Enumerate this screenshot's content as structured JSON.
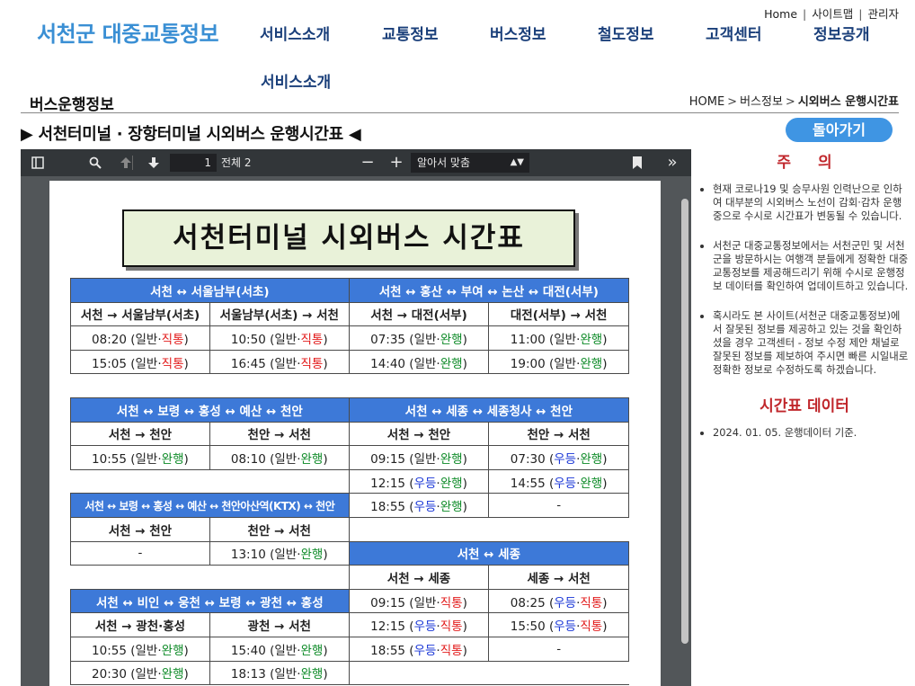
{
  "util": [
    "Home",
    "사이트맵",
    "관리자"
  ],
  "logo": "서천군 대중교통정보",
  "gnb": [
    "서비스소개",
    "교통정보",
    "버스정보",
    "철도정보",
    "고객센터",
    "정보공개"
  ],
  "sub_nav": "서비스소개",
  "page_title": "버스운행정보",
  "breadcrumb": {
    "home": "HOME",
    "mid": "버스정보",
    "current": "시외버스 운행시간표"
  },
  "schedule_title": "▶ 서천터미널 · 장항터미널 시외버스 운행시간표 ◀",
  "back_button": "돌아가기",
  "viewer": {
    "page_current": "1",
    "page_total": "전체 2",
    "zoom": "알아서 맞춤",
    "doc_title": "서천터미널  시외버스  시간표"
  },
  "timetable": {
    "rows": [
      [
        {
          "t": "서천 ↔ 서울남부(서초)",
          "c": "h",
          "span": 2
        },
        {
          "t": "서천 ↔ 홍산 ↔ 부여 ↔ 논산 ↔ 대전(서부)",
          "c": "h",
          "span": 2
        }
      ],
      [
        {
          "t": "서천 → 서울남부(서초)",
          "c": "sh"
        },
        {
          "t": "서울남부(서초) → 서천",
          "c": "sh"
        },
        {
          "t": "서천 → 대전(서부)",
          "c": "sh"
        },
        {
          "t": "대전(서부) → 서천",
          "c": "sh"
        }
      ],
      [
        {
          "time": "08:20",
          "a": "일반",
          "b": "직통"
        },
        {
          "time": "10:50",
          "a": "일반",
          "b": "직통"
        },
        {
          "time": "07:35",
          "a": "일반",
          "b": "완행"
        },
        {
          "time": "11:00",
          "a": "일반",
          "b": "완행"
        }
      ],
      [
        {
          "time": "15:05",
          "a": "일반",
          "b": "직통"
        },
        {
          "time": "16:45",
          "a": "일반",
          "b": "직통"
        },
        {
          "time": "14:40",
          "a": "일반",
          "b": "완행"
        },
        {
          "time": "19:00",
          "a": "일반",
          "b": "완행"
        }
      ],
      [
        {
          "t": "",
          "span": 4,
          "c": "blank"
        }
      ],
      [
        {
          "t": "서천 ↔ 보령 ↔ 홍성 ↔ 예산 ↔ 천안",
          "c": "h",
          "span": 2
        },
        {
          "t": "서천 ↔ 세종 ↔ 세종청사 ↔ 천안",
          "c": "h",
          "span": 2
        }
      ],
      [
        {
          "t": "서천 → 천안",
          "c": "sh"
        },
        {
          "t": "천안 → 서천",
          "c": "sh"
        },
        {
          "t": "서천 → 천안",
          "c": "sh"
        },
        {
          "t": "천안 → 서천",
          "c": "sh"
        }
      ],
      [
        {
          "time": "10:55",
          "a": "일반",
          "b": "완행"
        },
        {
          "time": "08:10",
          "a": "일반",
          "b": "완행"
        },
        {
          "time": "09:15",
          "a": "일반",
          "b": "완행"
        },
        {
          "time": "07:30",
          "a": "우등",
          "b": "완행"
        }
      ],
      [
        {
          "t": "",
          "span": 2,
          "c": "blank"
        },
        {
          "time": "12:15",
          "a": "우등",
          "b": "완행"
        },
        {
          "time": "14:55",
          "a": "우등",
          "b": "완행"
        }
      ],
      [
        {
          "t": "서천 ↔ 보령 ↔ 홍성 ↔ 예산 ↔ 천안아산역(KTX) ↔ 천안",
          "c": "h sm",
          "span": 2
        },
        {
          "time": "18:55",
          "a": "우등",
          "b": "완행"
        },
        {
          "t": "-"
        }
      ],
      [
        {
          "t": "서천 → 천안",
          "c": "sh"
        },
        {
          "t": "천안 → 서천",
          "c": "sh"
        },
        {
          "t": "",
          "span": 2,
          "c": "blank"
        }
      ],
      [
        {
          "t": "-"
        },
        {
          "time": "13:10",
          "a": "일반",
          "b": "완행"
        },
        {
          "t": "서천 ↔ 세종",
          "c": "h",
          "span": 2
        }
      ],
      [
        {
          "t": "",
          "span": 2,
          "c": "blank"
        },
        {
          "t": "서천 → 세종",
          "c": "sh"
        },
        {
          "t": "세종 → 서천",
          "c": "sh"
        }
      ],
      [
        {
          "t": "서천 ↔ 비인 ↔ 웅천 ↔ 보령 ↔ 광천 ↔ 홍성",
          "c": "h",
          "span": 2
        },
        {
          "time": "09:15",
          "a": "일반",
          "b": "직통"
        },
        {
          "time": "08:25",
          "a": "우등",
          "b": "직통"
        }
      ],
      [
        {
          "t": "서천 → 광천·홍성",
          "c": "sh"
        },
        {
          "t": "광천 → 서천",
          "c": "sh"
        },
        {
          "time": "12:15",
          "a": "우등",
          "b": "직통"
        },
        {
          "time": "15:50",
          "a": "우등",
          "b": "직통"
        }
      ],
      [
        {
          "time": "10:55",
          "a": "일반",
          "b": "완행"
        },
        {
          "time": "15:40",
          "a": "일반",
          "b": "완행"
        },
        {
          "time": "18:55",
          "a": "우등",
          "b": "직통"
        },
        {
          "t": "-"
        }
      ],
      [
        {
          "time": "20:30",
          "a": "일반",
          "b": "완행"
        },
        {
          "time": "18:13",
          "a": "일반",
          "b": "완행"
        },
        {
          "t": "",
          "span": 2,
          "c": "blank"
        }
      ]
    ]
  },
  "info": {
    "caution_title": "주 의",
    "caution_items": [
      "현재 코로나19 및 승무사원 인력난으로 인하여 대부분의 시외버스 노선이 감회·감차 운행중으로 수시로 시간표가 변동될 수 있습니다.",
      "서천군 대중교통정보에서는 서천군민 및 서천군을 방문하시는 여행객 분들에게 정확한 대중교통정보를 제공해드리기 위해 수시로 운행정보 데이터를 확인하여 업데이트하고 있습니다.",
      "혹시라도 본 사이트(서천군 대중교통정보)에서 잘못된 정보를 제공하고 있는 것을 확인하셨을 경우 고객센터 - 정보 수정 제안 채널로 잘못된 정보를 제보하여 주시면 빠른 시일내로 정확한 정보로 수정하도록 하겠습니다."
    ],
    "data_title": "시간표 데이터",
    "data_items": [
      "2024. 01. 05. 운행데이터 기준."
    ]
  },
  "colors": {
    "accent": "#3f95e3",
    "header_cell": "#3d79d8",
    "red": "#e21b1b",
    "green": "#0c8a26",
    "blue": "#1734d6"
  }
}
